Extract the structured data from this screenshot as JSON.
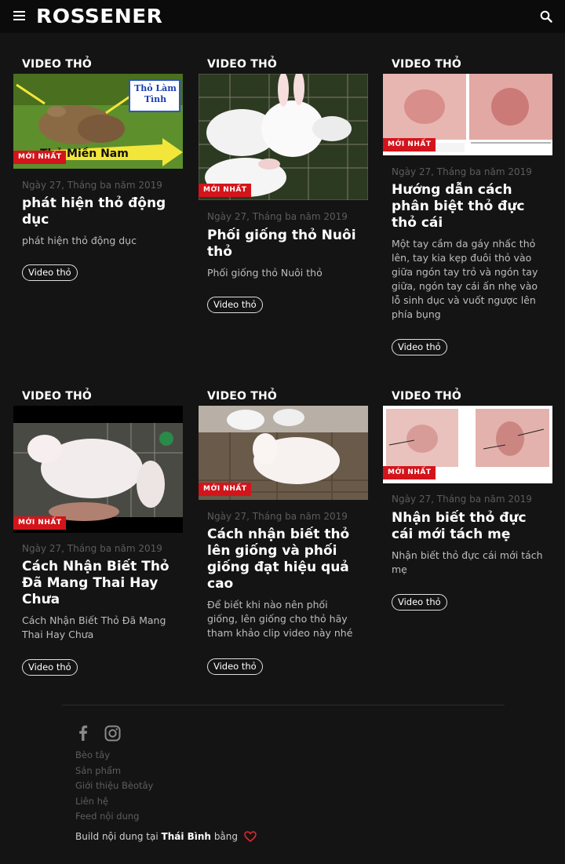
{
  "header": {
    "logo": "ROSSENER",
    "menu_icon": "hamburger-menu-icon",
    "search_icon": "search-icon"
  },
  "badge_label": "MỚI NHẤT",
  "posts": [
    {
      "category": "VIDEO THỎ",
      "date": "Ngày 27, Tháng ba năm 2019",
      "title": "phát hiện thỏ động dục",
      "excerpt": "phát hiện thỏ động dục",
      "tag": "Video thỏ",
      "image_overlay": {
        "top_label": "Thỏ Làm Tình",
        "bottom_label": "Thỏ Miền Nam"
      }
    },
    {
      "category": "VIDEO THỎ",
      "date": "Ngày 27, Tháng ba năm 2019",
      "title": "Phối giống thỏ Nuôi thỏ",
      "excerpt": "Phối giống thỏ Nuôi thỏ",
      "tag": "Video thỏ"
    },
    {
      "category": "VIDEO THỎ",
      "date": "Ngày 27, Tháng ba năm 2019",
      "title": "Hướng dẫn cách phân biệt thỏ đực thỏ cái",
      "excerpt": "Một tay cầm da gáy nhấc thỏ lên, tay kia kẹp đuôi thỏ vào giữa ngón tay trỏ và ngón tay giữa, ngón tay cái ấn nhẹ vào lỗ sinh dục và vuốt ngược lên phía bụng",
      "tag": "Video thỏ"
    },
    {
      "category": "VIDEO THỎ",
      "date": "Ngày 27, Tháng ba năm 2019",
      "title": "Cách Nhận Biết Thỏ Đã Mang Thai Hay Chưa",
      "excerpt": "Cách Nhận Biết Thỏ Đã Mang Thai Hay Chưa",
      "tag": "Video thỏ"
    },
    {
      "category": "VIDEO THỎ",
      "date": "Ngày 27, Tháng ba năm 2019",
      "title": "Cách nhận biết thỏ lên giống và phối giống đạt hiệu quả cao",
      "excerpt": "Để biết khi nào nên phối giống, lên giống cho thỏ hãy tham khảo clip video này nhé",
      "tag": "Video thỏ"
    },
    {
      "category": "VIDEO THỎ",
      "date": "Ngày 27, Tháng ba năm 2019",
      "title": "Nhận biết thỏ đực cái mới tách mẹ",
      "excerpt": "Nhận biết thỏ đực cái mới tách mẹ",
      "tag": "Video thỏ"
    }
  ],
  "footer": {
    "social_icons": [
      "facebook-icon",
      "instagram-icon"
    ],
    "links": [
      "Bèo tây",
      "Sản phẩm",
      "Giới thiệu Bèotây",
      "Liên hệ",
      "Feed nội dung"
    ],
    "credit_prefix": "Build nội dung tại",
    "credit_place": "Thái Bình",
    "credit_suffix": "bằng",
    "credit_icon": "heart-icon",
    "heart_color": "#e2262e"
  },
  "colors": {
    "background": "#141414",
    "topbar": "#0b0b0b",
    "badge": "#d4141b"
  }
}
